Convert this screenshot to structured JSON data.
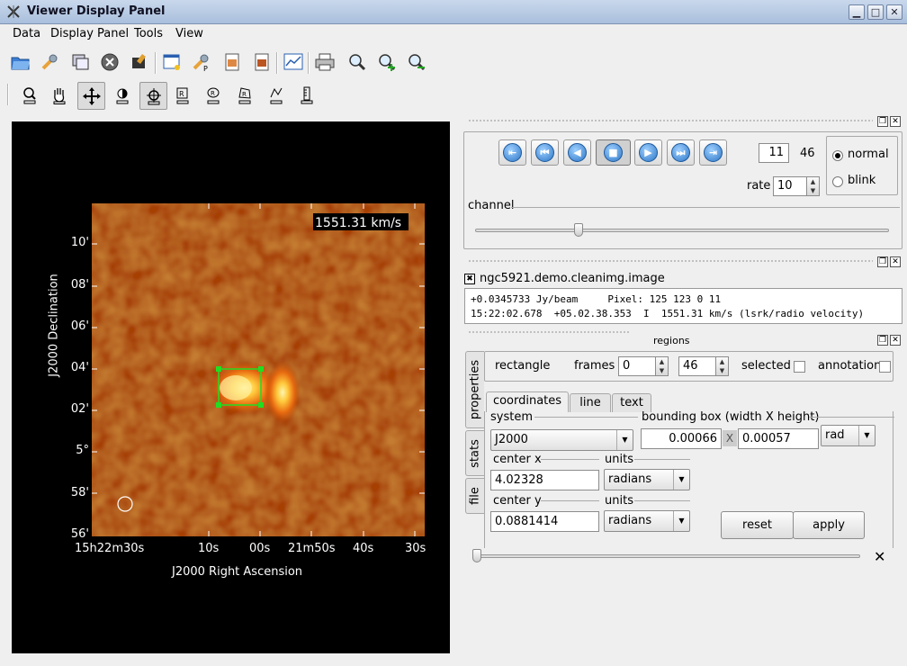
{
  "window": {
    "title": "Viewer Display Panel",
    "controls": [
      "minimize",
      "maximize",
      "close"
    ]
  },
  "menubar": [
    "Data",
    "Display Panel",
    "Tools",
    "View"
  ],
  "toolbar_icons": [
    "open-folder-icon",
    "wrench-icon",
    "new-panel-icon",
    "close-icon",
    "unload-icon",
    "panel-options-icon",
    "print-prefs-icon",
    "save-image-icon",
    "export-icon",
    "graph-icon",
    "printer-icon",
    "zoom-fit-icon",
    "zoom-in-icon",
    "zoom-out-icon"
  ],
  "mouse_tools": [
    "zoom-tool-icon",
    "pan-tool-icon",
    "move-tool-icon",
    "contrast-tool-icon",
    "crosshair-tool-icon",
    "rectangle-region-icon",
    "ellipse-region-icon",
    "polygon-region-icon",
    "polyline-icon",
    "ruler-icon"
  ],
  "image": {
    "velocity_label": "1551.31 km/s",
    "ylabel": "J2000 Declination",
    "xlabel": "J2000 Right Ascension",
    "yticks": [
      "10'",
      "08'",
      "06'",
      "04'",
      "02'",
      "5°",
      "58'",
      "56'"
    ],
    "xticks": [
      "15h22m30s",
      "10s",
      "00s",
      "21m50s",
      "40s",
      "30s"
    ]
  },
  "animator": {
    "frame": "11",
    "total": "46",
    "rate_label": "rate",
    "rate": "10",
    "mode_normal": "normal",
    "mode_blink": "blink",
    "channel_label": "channel",
    "channel_fraction": 0.25
  },
  "cursor_panel": {
    "image_name": "ngc5921.demo.cleanimg.image",
    "line1": "+0.0345733 Jy/beam     Pixel: 125 123 0 11",
    "line2": "15:22:02.678  +05.02.38.353  I  1551.31 km/s (lsrk/radio velocity)"
  },
  "regions": {
    "title": "regions",
    "shape": "rectangle",
    "frames_label": "frames",
    "frame_from": "0",
    "frame_to": "46",
    "selected_label": "selected",
    "annotation_label": "annotation",
    "side_tabs": [
      "properties",
      "stats",
      "file"
    ],
    "tabs": [
      "coordinates",
      "line",
      "text"
    ],
    "system_label": "system",
    "system": "J2000",
    "bbox_label": "bounding box (width X height)",
    "bbox_width": "0.00066",
    "bbox_x": "X",
    "bbox_height": "0.00057",
    "bbox_units": "rad",
    "center_x_label": "center x",
    "center_x": "4.02328",
    "center_y_label": "center y",
    "center_y": "0.0881414",
    "units_label": "units",
    "units_x": "radians",
    "units_y": "radians",
    "reset": "reset",
    "apply": "apply"
  },
  "colors": {
    "titlebar": "#b9cbe4",
    "image_hot": "#ffcf4a",
    "region": "#22dd22"
  }
}
